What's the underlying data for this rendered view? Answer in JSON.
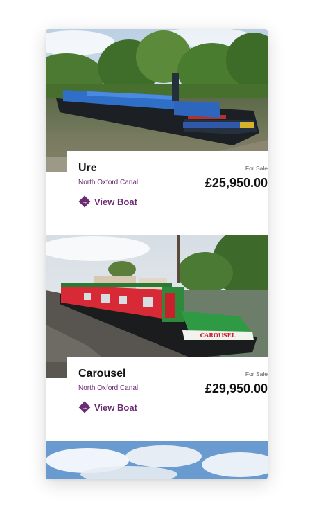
{
  "listings": [
    {
      "name": "Ure",
      "status": "For Sale",
      "location": "North Oxford Canal",
      "price": "£25,950.00",
      "cta_label": "View Boat",
      "photo": "narrowboat with blue tarpaulin cover moored on canal"
    },
    {
      "name": "Carousel",
      "status": "For Sale",
      "location": "North Oxford Canal",
      "price": "£29,950.00",
      "cta_label": "View Boat",
      "photo": "red and green narrowboat moored at gravel bank",
      "boat_sign": "CAROUSEL"
    }
  ],
  "colors": {
    "accent": "#6b2c74",
    "text": "#111111"
  },
  "icons": {
    "cta": "arrow-diamond-icon"
  }
}
